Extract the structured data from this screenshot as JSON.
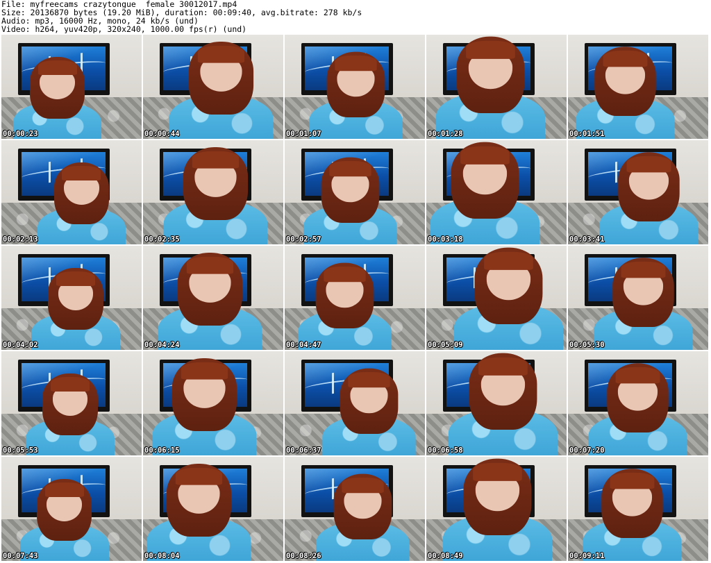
{
  "header": {
    "lines": [
      "File: myfreecams_crazytongue__female_30012017.mp4",
      "Size: 20136870 bytes (19.20 MiB), duration: 00:09:40, avg.bitrate: 278 kb/s",
      "Audio: mp3, 16000 Hz, mono, 24 kb/s (und)",
      "Video: h264, yuv420p, 320x240, 1000.00 fps(r) (und)"
    ]
  },
  "thumbnails": [
    {
      "timestamp": "00:00:23"
    },
    {
      "timestamp": "00:00:44"
    },
    {
      "timestamp": "00:01:07"
    },
    {
      "timestamp": "00:01:28"
    },
    {
      "timestamp": "00:01:51"
    },
    {
      "timestamp": "00:02:13"
    },
    {
      "timestamp": "00:02:35"
    },
    {
      "timestamp": "00:02:57"
    },
    {
      "timestamp": "00:03:18"
    },
    {
      "timestamp": "00:03:41"
    },
    {
      "timestamp": "00:04:02"
    },
    {
      "timestamp": "00:04:24"
    },
    {
      "timestamp": "00:04:47"
    },
    {
      "timestamp": "00:05:09"
    },
    {
      "timestamp": "00:05:30"
    },
    {
      "timestamp": "00:05:53"
    },
    {
      "timestamp": "00:06:15"
    },
    {
      "timestamp": "00:06:37"
    },
    {
      "timestamp": "00:06:58"
    },
    {
      "timestamp": "00:07:20"
    },
    {
      "timestamp": "00:07:43"
    },
    {
      "timestamp": "00:08:04"
    },
    {
      "timestamp": "00:08:26"
    },
    {
      "timestamp": "00:08:49"
    },
    {
      "timestamp": "00:09:11"
    }
  ]
}
